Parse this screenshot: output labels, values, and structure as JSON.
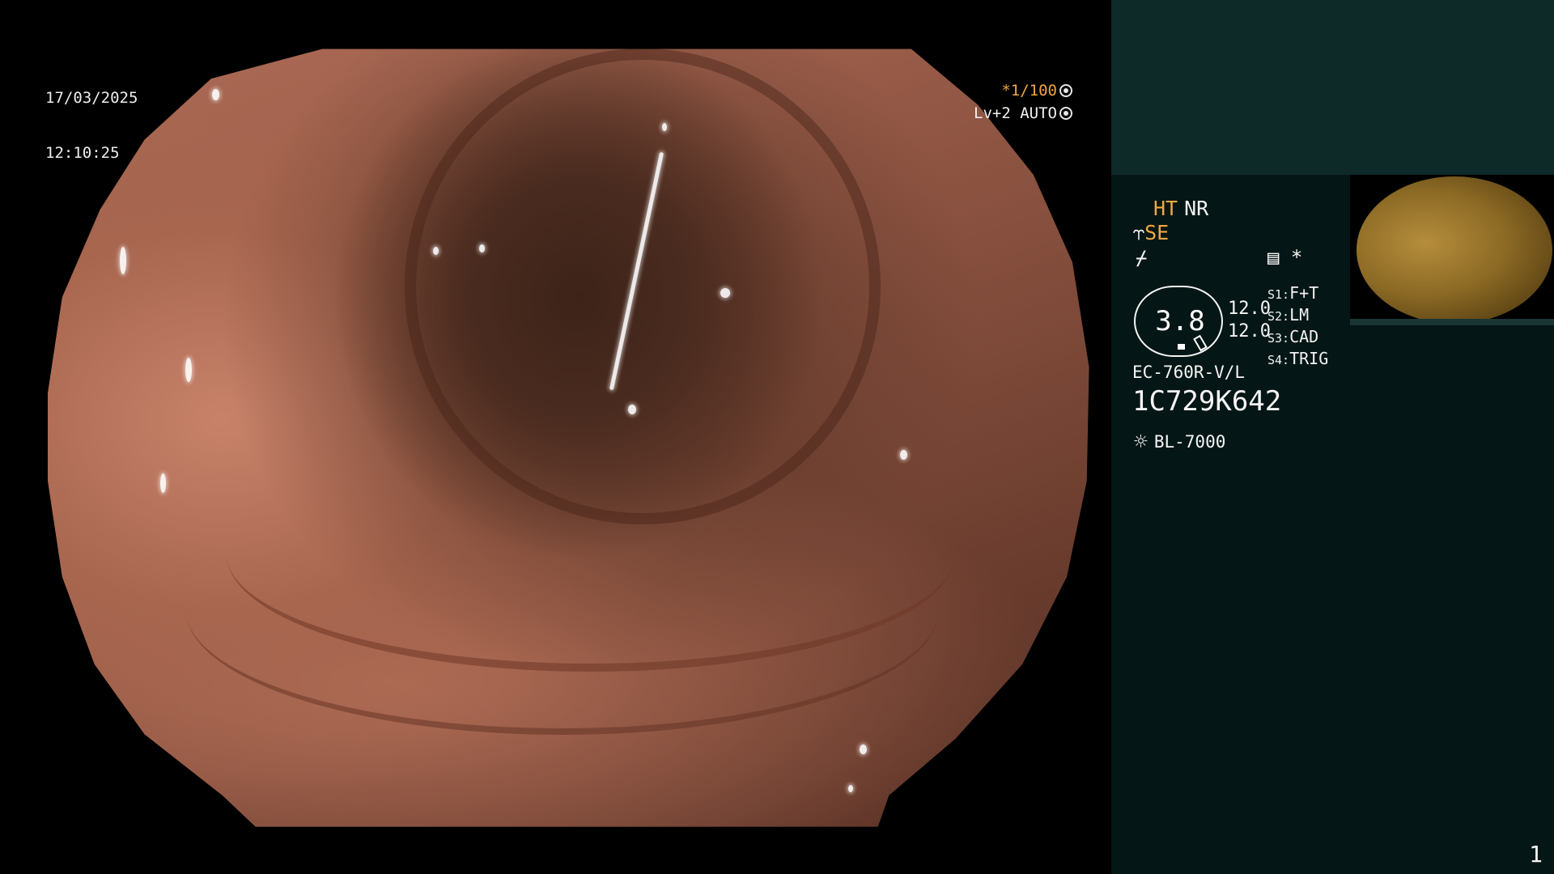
{
  "overlay": {
    "date": "17/03/2025",
    "time": "12:10:25",
    "shutter": "*1/100",
    "shutter_icon": "aperture-icon",
    "level": "Lv+2 AUTO",
    "level_icon": "auto-iris-icon"
  },
  "panel": {
    "ht_label": "HT",
    "nr_label": "NR",
    "se_icon": "scope-enhance-icon",
    "se_label": "SE",
    "noise_icon_glyph": "⌿",
    "memo_icon": "memo-icon",
    "asterisk": "*",
    "gauge_value": "3.8",
    "value_1": "12.0",
    "value_2": "12.0",
    "switches": [
      {
        "label": "S1:",
        "value": "F+T"
      },
      {
        "label": "S2:",
        "value": "LM"
      },
      {
        "label": "S3:",
        "value": "CAD"
      },
      {
        "label": "S4:",
        "value": "TRIG"
      }
    ],
    "model": "EC-760R-V/L",
    "serial": "1C729K642",
    "light_icon": "sun-icon",
    "light_source": "BL-7000",
    "page_number": "1"
  },
  "colors": {
    "panel_bg": "#041615",
    "panel_header": "#0d2a29",
    "accent_orange": "#f0a640"
  }
}
